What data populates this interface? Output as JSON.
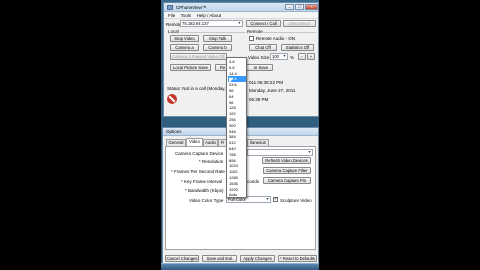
{
  "main_window": {
    "title": "CPhoneView™",
    "menu": [
      "File",
      "Tools",
      "Help / About"
    ],
    "remote_ip_label": "Remote IP",
    "remote_ip_value": "75.182.64.137",
    "connect_call": "Connect / Call",
    "disconnect": "Disconnect",
    "local_label": "Local",
    "remote_label": "Remote",
    "stop_video": "Stop Video",
    "stop_talk": "Stop Talk",
    "remote_audio_on": "Remote Audio - ON",
    "camera_a": "Camera a",
    "camera_b": "Camera b",
    "chat_off": "Chat Off",
    "statistics_off": "Statistics Off",
    "camera2_paused": "Camera 2 Paused Video Off",
    "video_size_label": "Video Size",
    "video_size_value": "100",
    "percent": "%",
    "local_picture_save": "Local Picture Save",
    "remote_picture_save_prefix": "Re",
    "remote_picture_save_suffix": "re Save",
    "status": "Status: Not in a call (Monday, Ju",
    "time_line1": "011 06:39:22 PM",
    "time_line2": "Monday, June 27, 2011",
    "time_line3": "06:39 PM"
  },
  "options_window": {
    "title": "Options",
    "tabs": [
      "General",
      "Video",
      "Audio",
      "Fi",
      "llaneous"
    ],
    "camera_capture_device": "Camera Capture Device",
    "resolution": "* Resolution",
    "refresh_video_devices": "Refresh Video Devices",
    "frames_per_second": "* Frames Per Second Rate",
    "camera_capture_filter": "Camera Capture Filter",
    "key_frame_interval": "* Key Frame Interval",
    "seconds": "conds",
    "camera_capture_pin": "Camera Capture Pin",
    "bandwidth": "* Bandwidth (Kbps)",
    "bandwidth_value": "128",
    "video_color_type": "Video Color Type",
    "video_color_value": "Full Color",
    "sculpture_video": "Sculpture Video",
    "cancel_changes": "Cancel Changes",
    "save_and_exit": "Save and Exit",
    "apply_changes": "Apply Changes",
    "reset_to_defaults": "* Reset to Defaults"
  },
  "dropdown": {
    "items": [
      "4.8",
      "9.6",
      "14.4",
      "28.8",
      "33.6",
      "56",
      "64",
      "96",
      "128",
      "192",
      "256",
      "300",
      "348",
      "384",
      "512",
      "640",
      "768",
      "896",
      "1024",
      "1152",
      "1280",
      "1536",
      "1920",
      "Auto"
    ],
    "selected_index": 3
  }
}
